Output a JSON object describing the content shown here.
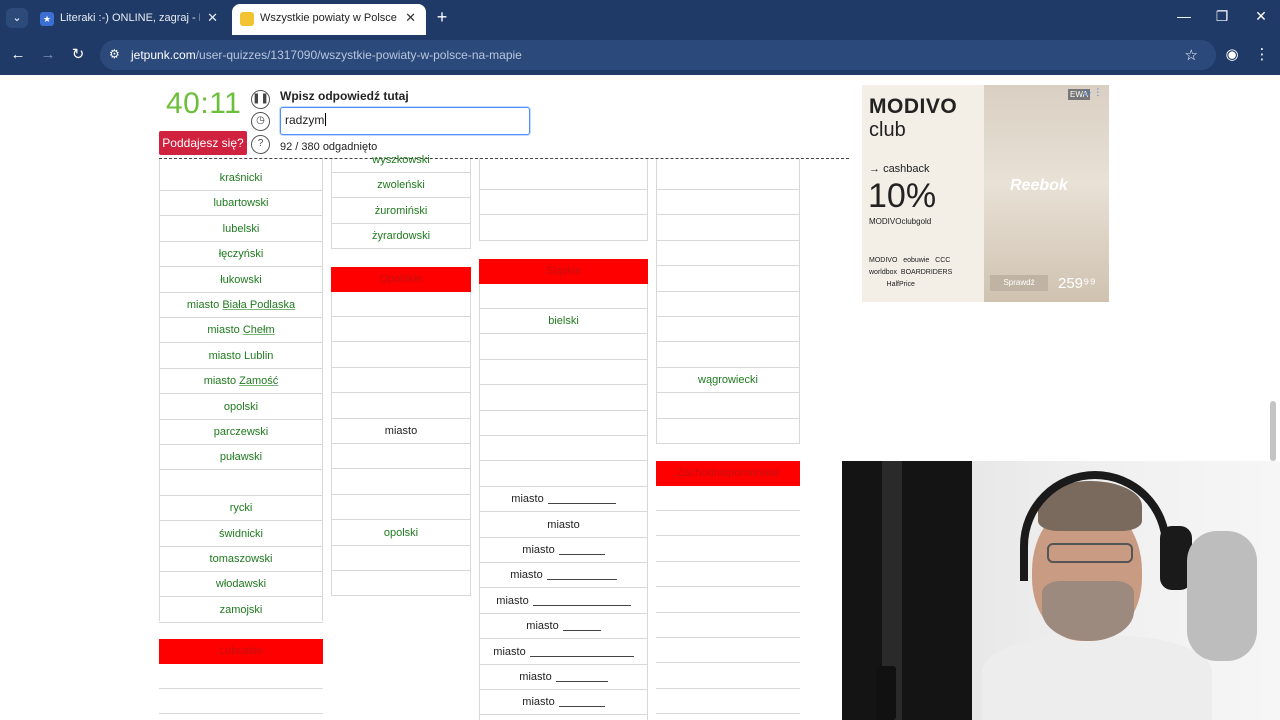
{
  "browser": {
    "tabs": [
      {
        "title": "Literaki :-) ONLINE, zagraj - Kur",
        "active": false,
        "favicon_color": "#3b6fd4"
      },
      {
        "title": "Wszystkie powiaty w Polsce na m",
        "active": true,
        "favicon_color": "#f2c230"
      }
    ],
    "url_host": "jetpunk.com",
    "url_path": "/user-quizzes/1317090/wszystkie-powiaty-w-polsce-na-mapie"
  },
  "quiz": {
    "timer": "40:11",
    "give_up_label": "Poddajesz się?",
    "answer_label": "Wpisz odpowiedź tutaj",
    "answer_value": "radzym",
    "progress": "92 / 380 odgadnięto",
    "progress_value": {
      "guessed": 92,
      "total": 380
    }
  },
  "columns": {
    "col1": {
      "rows": [
        "kraśnicki",
        "lubartowski",
        "lubelski",
        "łęczyński",
        "łukowski",
        "miasto Biała Podlaska",
        "miasto Chełm",
        "miasto Lublin",
        "miasto Zamość",
        "opolski",
        "parczewski",
        "puławski",
        "",
        "rycki",
        "świdnicki",
        "tomaszowski",
        "włodawski",
        "zamojski"
      ],
      "header": "Lubuskie"
    },
    "col2": {
      "top_rows": [
        "wyszkowski",
        "zwoleński",
        "żuromiński",
        "żyrardowski"
      ],
      "header": "Opolskie",
      "rows": [
        "",
        "",
        "",
        "",
        "",
        "miasto",
        "",
        "",
        "",
        "opolski",
        "",
        ""
      ]
    },
    "col3": {
      "header": "Śląskie",
      "rows": [
        "",
        "bielski",
        "",
        "",
        "",
        "",
        "",
        "",
        "miasto",
        "miasto",
        "miasto",
        "miasto",
        "miasto",
        "miasto",
        "miasto",
        "miasto",
        "miasto"
      ]
    },
    "col4": {
      "rows": [
        "",
        "",
        "",
        "",
        "",
        "",
        "",
        "",
        "wągrowiecki",
        "",
        "",
        ""
      ],
      "header": "Zachodniopomorskie"
    }
  },
  "ad": {
    "brand_line1": "MODIVO",
    "brand_line2": "club",
    "cashback": "cashback",
    "percent": "10%",
    "clubgold": "MODIVOclubgold",
    "brands": [
      "MODIVO",
      "eobuwie",
      "CCC",
      "worldbox",
      "BOARDRIDERS",
      "HalfPrice"
    ],
    "ewa": "EWA",
    "reebok": "Reebok",
    "cta": "Sprawdź",
    "price": "259⁹⁹"
  }
}
